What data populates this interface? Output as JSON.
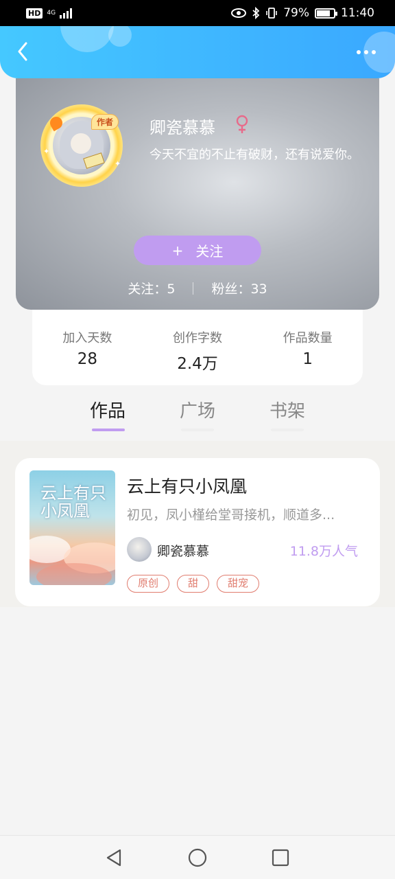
{
  "status_bar": {
    "hd_label": "HD",
    "network": "4G",
    "battery": "79%",
    "time": "11:40"
  },
  "header": {
    "back_icon": "back-chevron-icon",
    "more_icon": "more-dots-icon"
  },
  "profile": {
    "author_badge": "作者",
    "name": "卿瓷慕慕",
    "gender_icon": "female-icon",
    "gender_color": "#e86a8a",
    "bio": "今天不宜的不止有破财，还有说爱你。",
    "follow_button": "关注",
    "follow_plus": "+",
    "following_label": "关注：5",
    "fans_label": "粉丝：33"
  },
  "stats": [
    {
      "label": "加入天数",
      "value": "28"
    },
    {
      "label": "创作字数",
      "value": "2.4万"
    },
    {
      "label": "作品数量",
      "value": "1"
    }
  ],
  "tabs": [
    {
      "label": "作品",
      "active": true
    },
    {
      "label": "广场",
      "active": false
    },
    {
      "label": "书架",
      "active": false
    }
  ],
  "works": [
    {
      "cover_title": "云上有只小凤凰",
      "title": "云上有只小凤凰",
      "description": "初见，凤小槿给堂哥接机，顺道多...",
      "author": "卿瓷慕慕",
      "popularity": "11.8万人气",
      "tags": [
        "原创",
        "甜",
        "甜宠"
      ]
    }
  ],
  "colors": {
    "accent": "#c09cf0",
    "header": "#3aa8ff",
    "tag": "#e07c6e"
  }
}
